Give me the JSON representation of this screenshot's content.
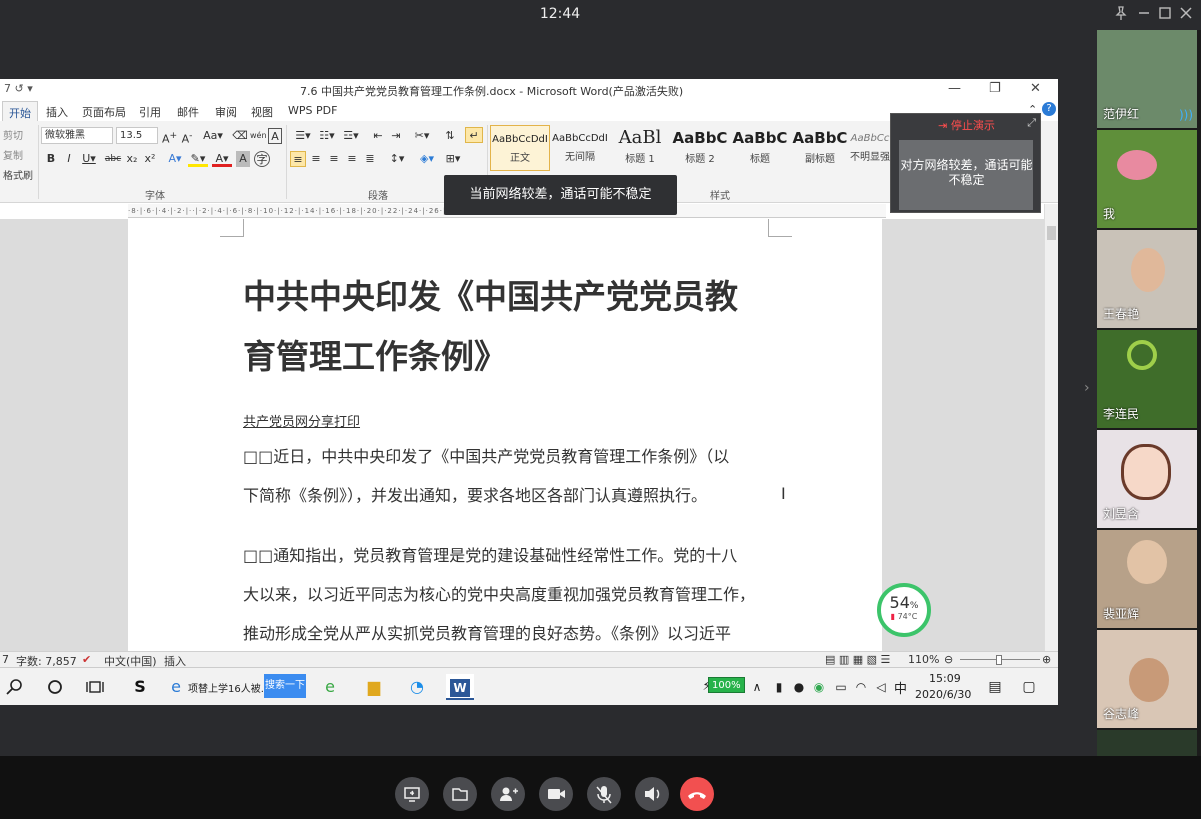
{
  "meeting": {
    "time": "12:44"
  },
  "word": {
    "window_title": "7.6 中国共产党党员教育管理工作条例.docx - Microsoft Word(产品激活失败)",
    "tabs": [
      "开始",
      "插入",
      "页面布局",
      "引用",
      "邮件",
      "审阅",
      "视图",
      "WPS PDF"
    ],
    "ribbon": {
      "clipboard": [
        "剪切",
        "复制",
        "格式刷"
      ],
      "font_name": "微软雅黑",
      "font_size": "13.5",
      "group_font": "字体",
      "group_paragraph": "段落",
      "group_styles": "样式",
      "styles": [
        {
          "sample": "AaBbCcDdI",
          "name": "正文"
        },
        {
          "sample": "AaBbCcDdI",
          "name": "无间隔"
        },
        {
          "sample": "AaBl",
          "name": "标题 1"
        },
        {
          "sample": "AaBbC",
          "name": "标题 2"
        },
        {
          "sample": "AaBbC",
          "name": "标题"
        },
        {
          "sample": "AaBbC",
          "name": "副标题"
        },
        {
          "sample": "AaBbCc",
          "name": "不明显强"
        }
      ]
    },
    "document": {
      "title_line1": "中共中央印发《中国共产党党员教",
      "title_line2": "育管理工作条例》",
      "source": "共产党员网分享打印",
      "p1_line1": "□□近日，中共中央印发了《中国共产党党员教育管理工作条例》（以",
      "p1_line2": "下简称《条例》），并发出通知，要求各地区各部门认真遵照执行。",
      "p2_line1": "□□通知指出，党员教育管理是党的建设基础性经常性工作。党的十八",
      "p2_line2": "大以来，以习近平同志为核心的党中央高度重视加强党员教育管理工作，",
      "p2_line3": "推动形成全党从严从实抓党员教育管理的良好态势。《条例》以习近平"
    },
    "status": {
      "page": "7",
      "word_count": "字数: 7,857",
      "language": "中文(中国)",
      "mode": "插入",
      "zoom": "110%"
    }
  },
  "taskbar": {
    "browser_task": "项替上学16人被...",
    "search_btn": "搜索一下",
    "battery": "100%",
    "ime": "中",
    "time": "15:09",
    "date": "2020/6/30"
  },
  "overlay": {
    "network_toast": "当前网络较差，通话可能不稳定",
    "stop_share": "停止演示",
    "peer_network": "对方网络较差，通话可能不稳定",
    "cpu_percent": "54",
    "cpu_unit": "%",
    "temperature": "74°C"
  },
  "participants": [
    {
      "name": "范伊红",
      "color": "#6c8a6a"
    },
    {
      "name": "我",
      "color": "#5f8f3a"
    },
    {
      "name": "王春艳",
      "color": "#c9c2b8"
    },
    {
      "name": "李连民",
      "color": "#3f6d2a"
    },
    {
      "name": "刘昱含",
      "color": "#e8e2e6"
    },
    {
      "name": "裴亚辉",
      "color": "#b7a189"
    },
    {
      "name": "谷志峰",
      "color": "#d9c6b5"
    },
    {
      "name": "",
      "color": "#2a3a2a"
    }
  ],
  "colors": {
    "accent_word": "#2b5797",
    "hangup": "#f25050",
    "gauge": "#3cc46a"
  }
}
